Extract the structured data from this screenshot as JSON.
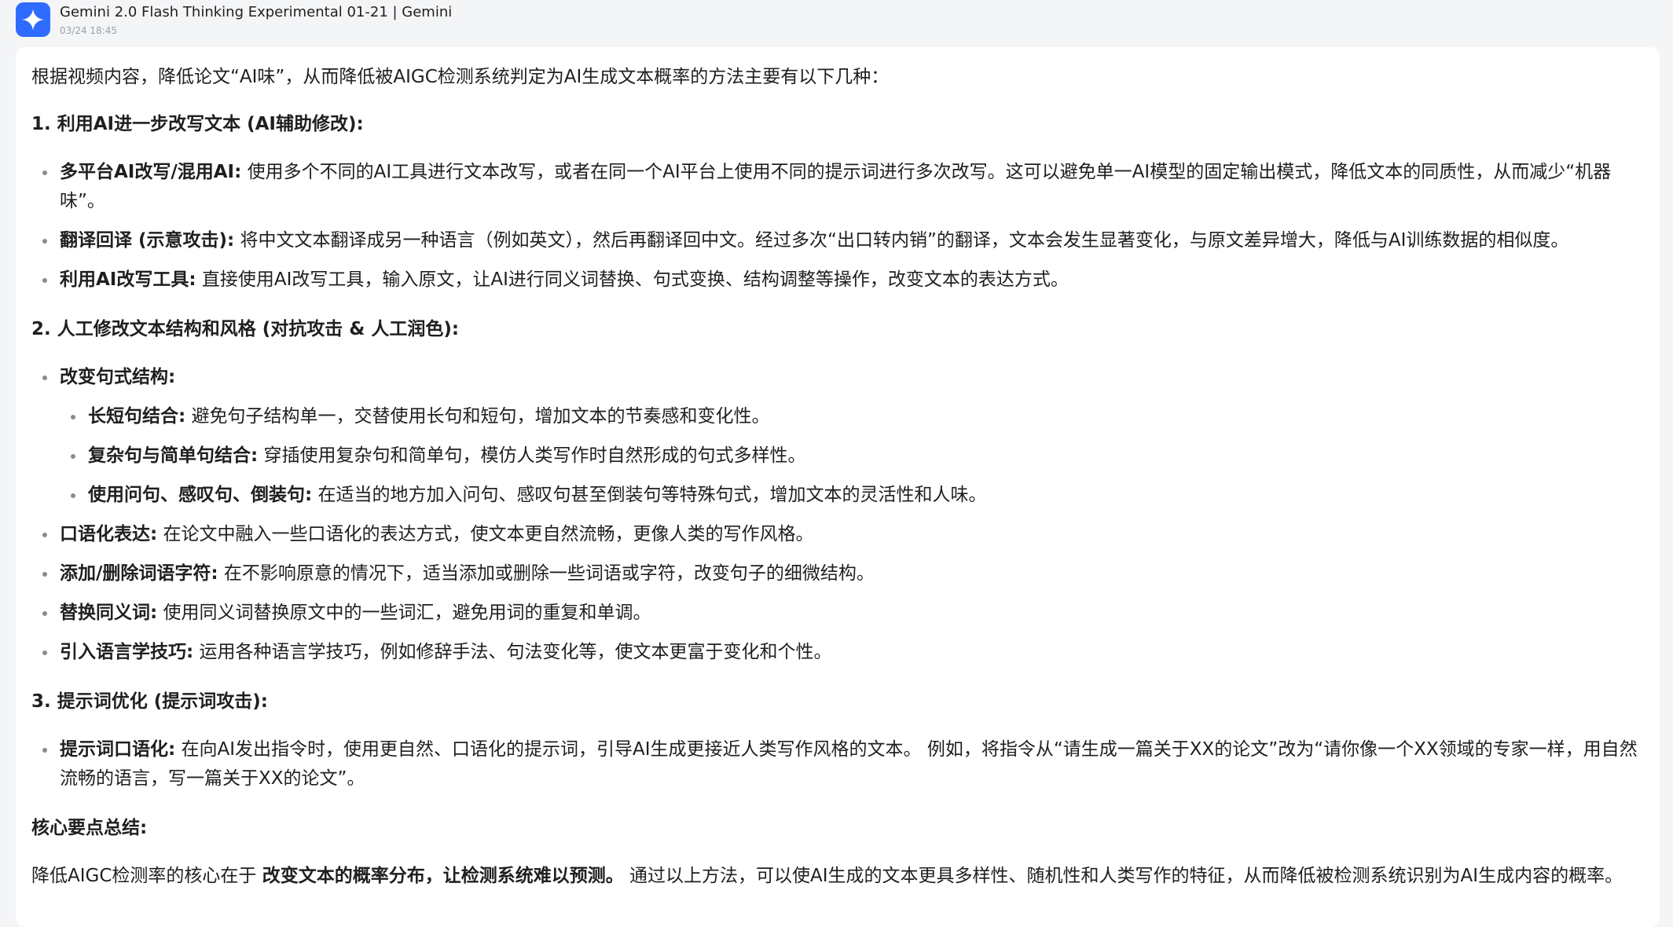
{
  "header": {
    "title": "Gemini 2.0 Flash Thinking Experimental 01-21 | Gemini",
    "timestamp": "03/24 18:45",
    "avatar_icon": "gemini-sparkle-icon",
    "avatar_color": "#2f6bff"
  },
  "message": {
    "intro": "根据视频内容，降低论文“AI味”，从而降低被AIGC检测系统判定为AI生成文本概率的方法主要有以下几种：",
    "section1": {
      "heading": "1. 利用AI进一步改写文本 (AI辅助修改):",
      "items": [
        {
          "label": "多平台AI改写/混用AI:",
          "text": " 使用多个不同的AI工具进行文本改写，或者在同一个AI平台上使用不同的提示词进行多次改写。这可以避免单一AI模型的固定输出模式，降低文本的同质性，从而减少“机器味”。"
        },
        {
          "label": "翻译回译 (示意攻击):",
          "text": " 将中文文本翻译成另一种语言（例如英文），然后再翻译回中文。经过多次“出口转内销”的翻译，文本会发生显著变化，与原文差异增大，降低与AI训练数据的相似度。"
        },
        {
          "label": "利用AI改写工具:",
          "text": " 直接使用AI改写工具，输入原文，让AI进行同义词替换、句式变换、结构调整等操作，改变文本的表达方式。"
        }
      ]
    },
    "section2": {
      "heading": "2. 人工修改文本结构和风格 (对抗攻击 & 人工润色):",
      "parent_label": "改变句式结构:",
      "subitems": [
        {
          "label": "长短句结合:",
          "text": " 避免句子结构单一，交替使用长句和短句，增加文本的节奏感和变化性。"
        },
        {
          "label": "复杂句与简单句结合:",
          "text": " 穿插使用复杂句和简单句，模仿人类写作时自然形成的句式多样性。"
        },
        {
          "label": "使用问句、感叹句、倒装句:",
          "text": " 在适当的地方加入问句、感叹句甚至倒装句等特殊句式，增加文本的灵活性和人味。"
        }
      ],
      "items": [
        {
          "label": "口语化表达:",
          "text": " 在论文中融入一些口语化的表达方式，使文本更自然流畅，更像人类的写作风格。"
        },
        {
          "label": "添加/删除词语字符:",
          "text": " 在不影响原意的情况下，适当添加或删除一些词语或字符，改变句子的细微结构。"
        },
        {
          "label": "替换同义词:",
          "text": " 使用同义词替换原文中的一些词汇，避免用词的重复和单调。"
        },
        {
          "label": "引入语言学技巧:",
          "text": " 运用各种语言学技巧，例如修辞手法、句法变化等，使文本更富于变化和个性。"
        }
      ]
    },
    "section3": {
      "heading": "3. 提示词优化 (提示词攻击):",
      "items": [
        {
          "label": "提示词口语化:",
          "text": " 在向AI发出指令时，使用更自然、口语化的提示词，引导AI生成更接近人类写作风格的文本。 例如，将指令从“请生成一篇关于XX的论文”改为“请你像一个XX领域的专家一样，用自然流畅的语言，写一篇关于XX的论文”。"
        }
      ]
    },
    "summary": {
      "heading": "核心要点总结:",
      "prefix": "降低AIGC检测率的核心在于 ",
      "bold": "改变文本的概率分布，让检测系统难以预测。",
      "suffix": " 通过以上方法，可以使AI生成的文本更具多样性、随机性和人类写作的特征，从而降低被检测系统识别为AI生成内容的概率。"
    }
  }
}
